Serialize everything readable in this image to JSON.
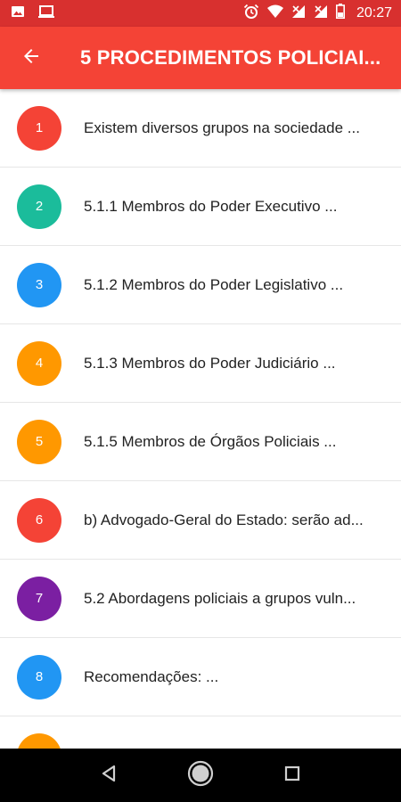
{
  "status_bar": {
    "time": "20:27",
    "icons_left": [
      "image-icon",
      "laptop-icon"
    ],
    "icons_right": [
      "alarm-icon",
      "wifi-icon",
      "signal-icon",
      "signal-icon",
      "battery-icon"
    ]
  },
  "app_bar": {
    "title": "5 PROCEDIMENTOS POLICIAI...",
    "back_icon": "arrow-left-icon",
    "color": "#f44336"
  },
  "list": {
    "items": [
      {
        "number": "1",
        "text": "Existem diversos grupos na sociedade ...",
        "color": "#f44336"
      },
      {
        "number": "2",
        "text": "5.1.1 Membros do Poder Executivo ...",
        "color": "#1bbc9b"
      },
      {
        "number": "3",
        "text": "5.1.2 Membros do Poder Legislativo ...",
        "color": "#2196f3"
      },
      {
        "number": "4",
        "text": "5.1.3 Membros do Poder Judiciário ...",
        "color": "#ff9800"
      },
      {
        "number": "5",
        "text": "5.1.5 Membros de Órgãos Policiais ...",
        "color": "#ff9800"
      },
      {
        "number": "6",
        "text": "b) Advogado-Geral do Estado: serão ad...",
        "color": "#f44336"
      },
      {
        "number": "7",
        "text": "5.2 Abordagens policiais a grupos vuln...",
        "color": "#7b1fa2"
      },
      {
        "number": "8",
        "text": "Recomendações: ...",
        "color": "#2196f3"
      },
      {
        "number": "",
        "text": "",
        "color": "#ff9800"
      }
    ]
  },
  "nav_bar": {
    "buttons": [
      "back-triangle-icon",
      "home-circle-icon",
      "recents-square-icon"
    ]
  }
}
